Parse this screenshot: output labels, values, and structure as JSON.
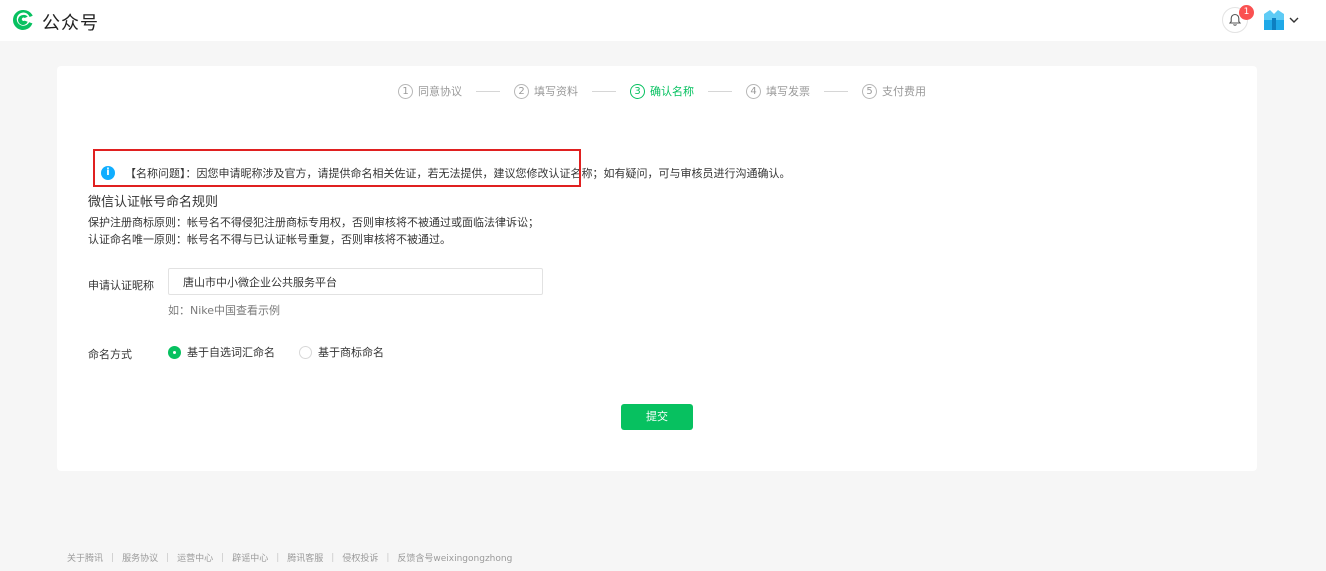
{
  "header": {
    "brand": "公众号",
    "notification_count": "1",
    "brand_color": "#07c160"
  },
  "steps": [
    {
      "num": "1",
      "label": "同意协议"
    },
    {
      "num": "2",
      "label": "填写资料"
    },
    {
      "num": "3",
      "label": "确认名称"
    },
    {
      "num": "4",
      "label": "填写发票"
    },
    {
      "num": "5",
      "label": "支付费用"
    }
  ],
  "active_step": 3,
  "notice": {
    "icon": "i",
    "text": "【名称问题】：因您申请昵称涉及官方，请提供命名相关佐证，若无法提供，建议您修改认证名称；如有疑问，可与审核员进行沟通确认。"
  },
  "rules": {
    "title": "微信认证帐号命名规则",
    "items": [
      "保护注册商标原则：帐号名不得侵犯注册商标专用权，否则审核将不被通过或面临法律诉讼；",
      "认证命名唯一原则：帐号名不得与已认证帐号重复，否则审核将不被通过。"
    ]
  },
  "form": {
    "name_label": "申请认证昵称",
    "name_value": "唐山市中小微企业公共服务平台",
    "example_text": "如：Nike中国查看示例",
    "naming_label": "命名方式",
    "naming_options": [
      {
        "label": "基于自选词汇命名",
        "checked": true
      },
      {
        "label": "基于商标命名",
        "checked": false
      }
    ],
    "submit_label": "提交"
  },
  "footer": {
    "links": [
      "关于腾讯",
      "服务协议",
      "运营中心",
      "辟谣中心",
      "腾讯客服",
      "侵权投诉",
      "反馈含号weixingongzhong"
    ]
  }
}
